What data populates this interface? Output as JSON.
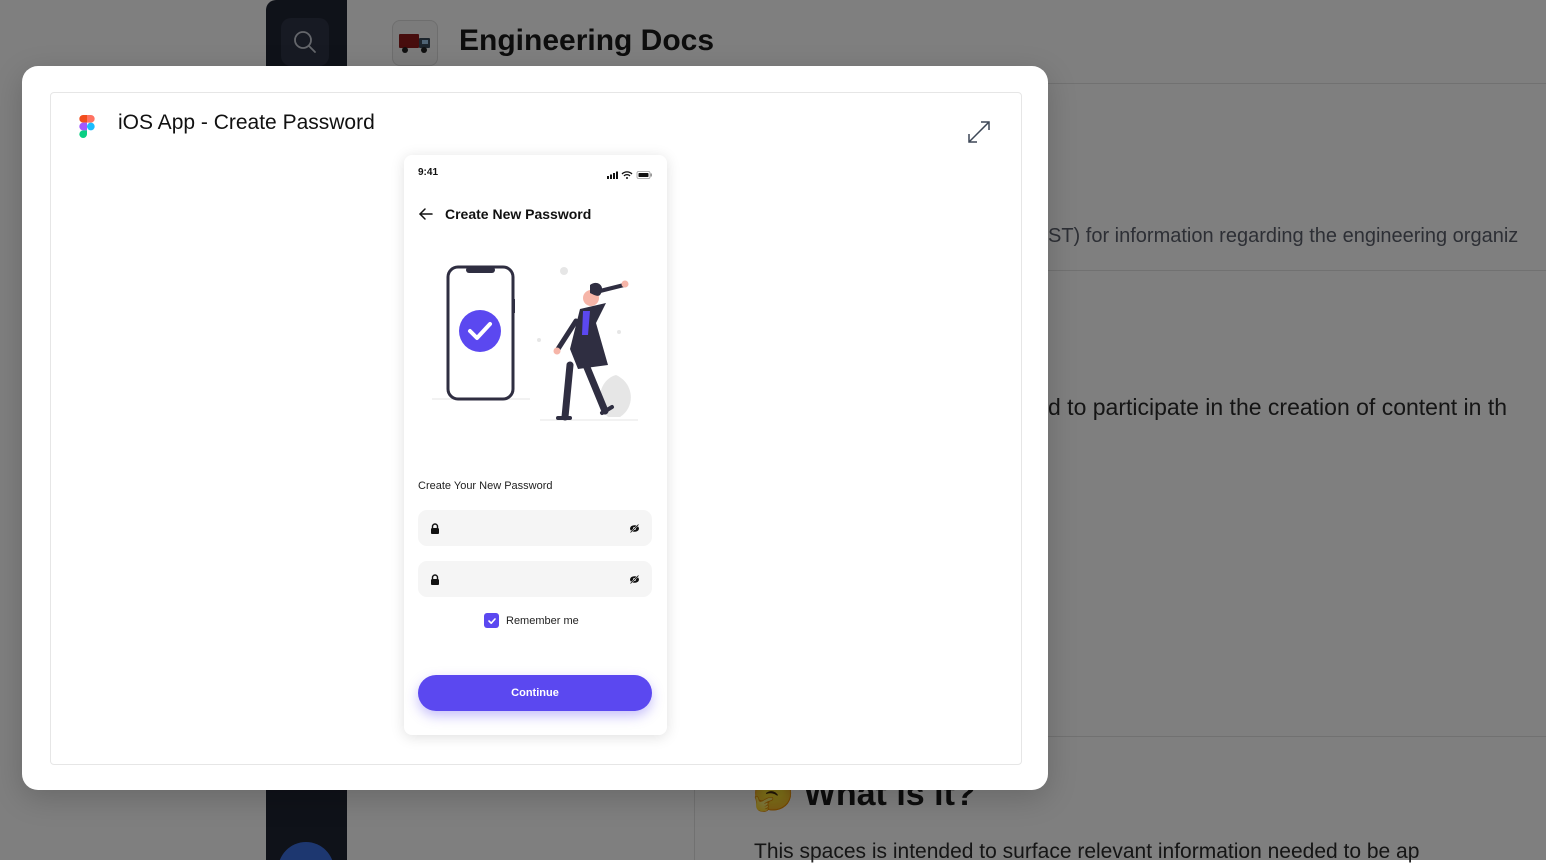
{
  "background": {
    "space_title": "Engineering Docs",
    "space_icon": "truck-icon",
    "content_line_1": "ST) for information regarding the engineering organiz",
    "content_line_2": "d to participate in the creation of content in th",
    "section_heading": "🤔 What is it?",
    "section_paragraph": "This spaces is intended to surface relevant information needed to be ap"
  },
  "modal": {
    "embed_title": "iOS App - Create Password",
    "embed_source_icon": "figma-logo-icon",
    "expand_icon": "expand-icon"
  },
  "phone": {
    "status_time": "9:41",
    "screen_title": "Create New Password",
    "field_label": "Create Your New Password",
    "password_1_value": "",
    "password_2_value": "",
    "remember_label": "Remember me",
    "remember_checked": true,
    "continue_label": "Continue"
  },
  "colors": {
    "accent": "#5b48f0",
    "sidebar": "#1f2433",
    "overlay": "rgba(0,0,0,0.5)"
  }
}
